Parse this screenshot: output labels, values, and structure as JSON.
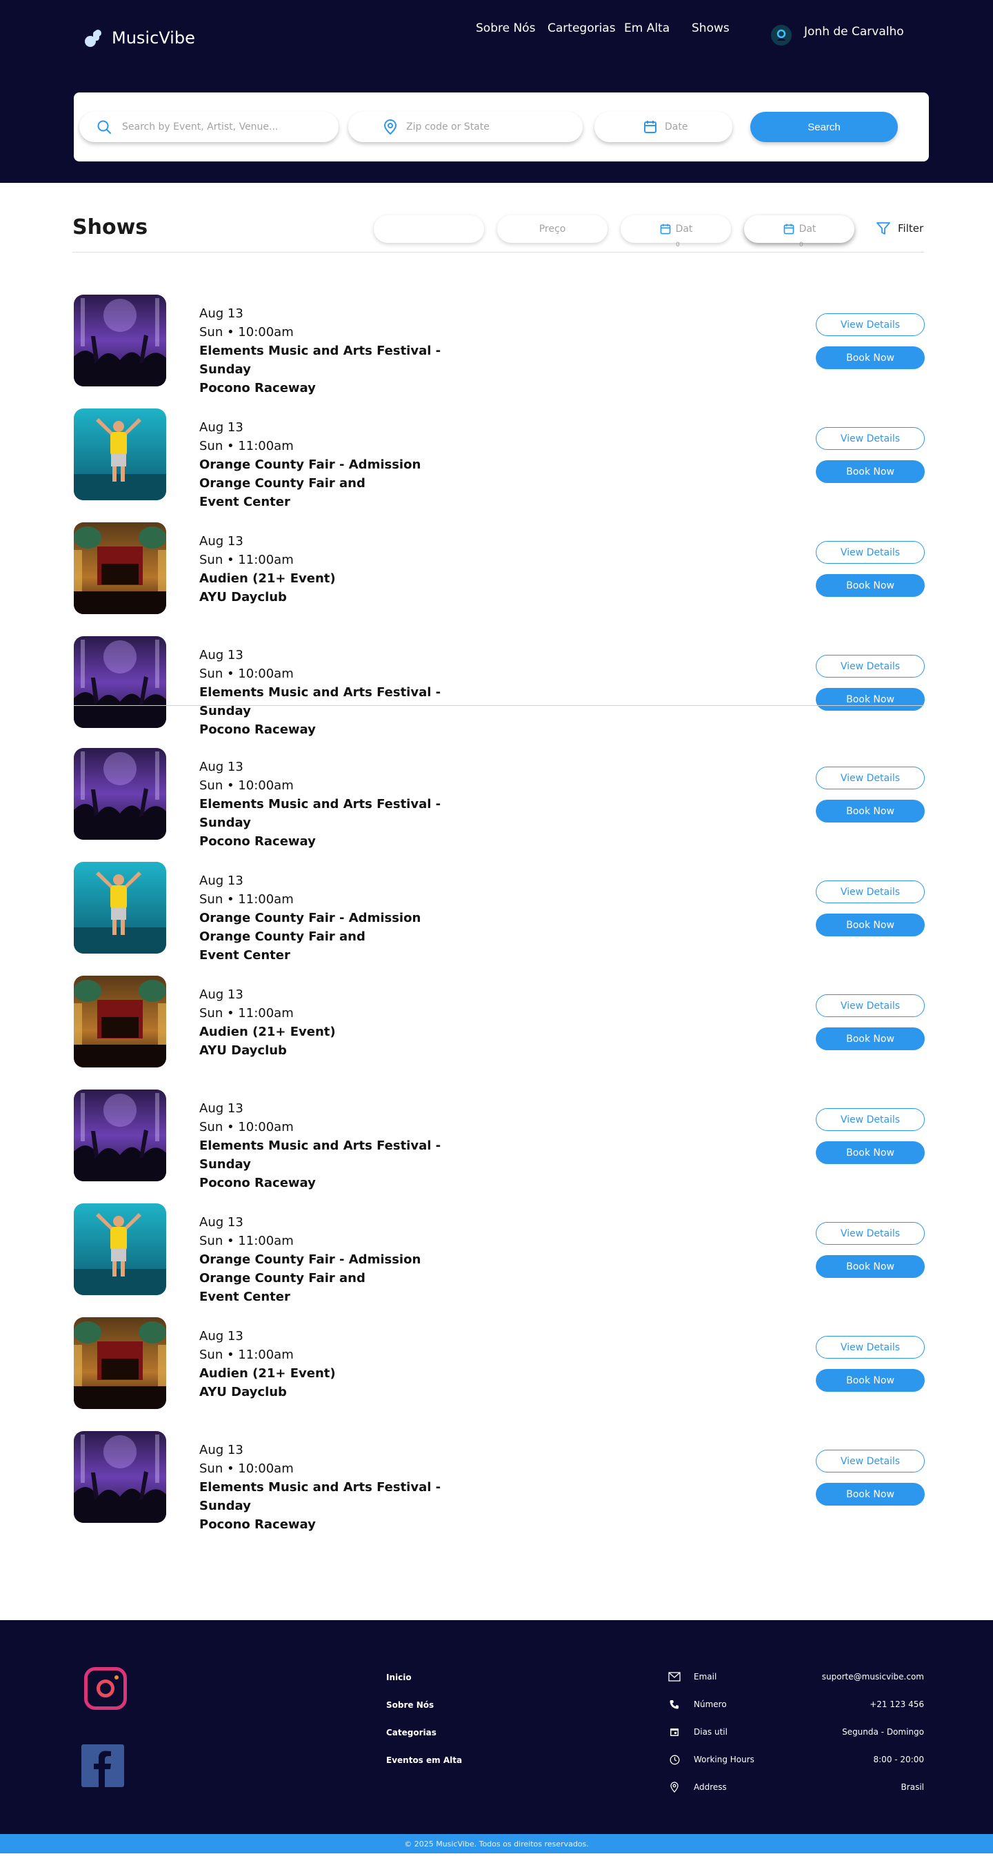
{
  "brand": {
    "name": "MusicVibe",
    "accent": "#2d97ee",
    "dark": "#0a0b2e"
  },
  "nav": {
    "items": [
      "Sobre Nós",
      "Cartegorias",
      "Em Alta",
      "Shows"
    ],
    "user_name": "Jonh de Carvalho"
  },
  "search": {
    "query_placeholder": "Search by Event,  Artist, Venue...",
    "location_placeholder": "Zip code or State",
    "date_placeholder": "Date",
    "button_label": "Search"
  },
  "shows": {
    "title": "Shows",
    "filters": {
      "first": "",
      "price": "Preço",
      "date_from": "Dat",
      "date_to": "Dat",
      "marker": "0",
      "filter_label": "Filter"
    },
    "view_label": "View Details",
    "book_label": "Book Now",
    "events": [
      {
        "image": "festival-crowd",
        "date": "Aug 13",
        "time": "Sun • 10:00am",
        "title": "Elements Music and Arts Festival - Sunday",
        "venue": "Pocono Raceway"
      },
      {
        "image": "performer-stage",
        "date": "Aug 13",
        "time": "Sun • 11:00am",
        "title": "Orange County Fair - Admission",
        "venue": "Orange County Fair and Event Center"
      },
      {
        "image": "theater-hall",
        "date": "Aug 13",
        "time": "Sun • 11:00am",
        "title": "Audien (21+ Event)",
        "venue": "AYU Dayclub"
      },
      {
        "image": "festival-crowd",
        "date": "Aug 13",
        "time": "Sun • 10:00am",
        "title": "Elements Music and Arts Festival - Sunday",
        "venue": "Pocono Raceway"
      },
      {
        "image": "festival-crowd",
        "date": "Aug 13",
        "time": "Sun • 10:00am",
        "title": "Elements Music and Arts Festival - Sunday",
        "venue": "Pocono Raceway"
      },
      {
        "image": "performer-stage",
        "date": "Aug 13",
        "time": "Sun • 11:00am",
        "title": "Orange County Fair - Admission",
        "venue": "Orange County Fair and Event Center"
      },
      {
        "image": "theater-hall",
        "date": "Aug 13",
        "time": "Sun • 11:00am",
        "title": "Audien (21+ Event)",
        "venue": "AYU Dayclub"
      },
      {
        "image": "festival-crowd",
        "date": "Aug 13",
        "time": "Sun • 10:00am",
        "title": "Elements Music and Arts Festival - Sunday",
        "venue": "Pocono Raceway"
      },
      {
        "image": "performer-stage",
        "date": "Aug 13",
        "time": "Sun • 11:00am",
        "title": "Orange County Fair - Admission",
        "venue": "Orange County Fair and Event Center"
      },
      {
        "image": "theater-hall",
        "date": "Aug 13",
        "time": "Sun • 11:00am",
        "title": "Audien (21+ Event)",
        "venue": "AYU Dayclub"
      },
      {
        "image": "festival-crowd",
        "date": "Aug 13",
        "time": "Sun • 10:00am",
        "title": "Elements Music and Arts Festival - Sunday",
        "venue": "Pocono Raceway"
      }
    ]
  },
  "footer": {
    "links": [
      "Inicio",
      "Sobre Nós",
      "Categorias",
      "Eventos em Alta"
    ],
    "contact": [
      {
        "icon": "mail-icon",
        "label": "Email",
        "value": "suporte@musicvibe.com"
      },
      {
        "icon": "phone-icon",
        "label": "Número",
        "value": "+21 123 456"
      },
      {
        "icon": "calendar-icon",
        "label": "Dias util",
        "value": "Segunda - Domingo"
      },
      {
        "icon": "clock-icon",
        "label": "Working Hours",
        "value": "8:00 - 20:00"
      },
      {
        "icon": "location-icon",
        "label": "Address",
        "value": "Brasil"
      }
    ],
    "copyright": "© 2025 MusicVibe. Todos os direitos reservados."
  }
}
